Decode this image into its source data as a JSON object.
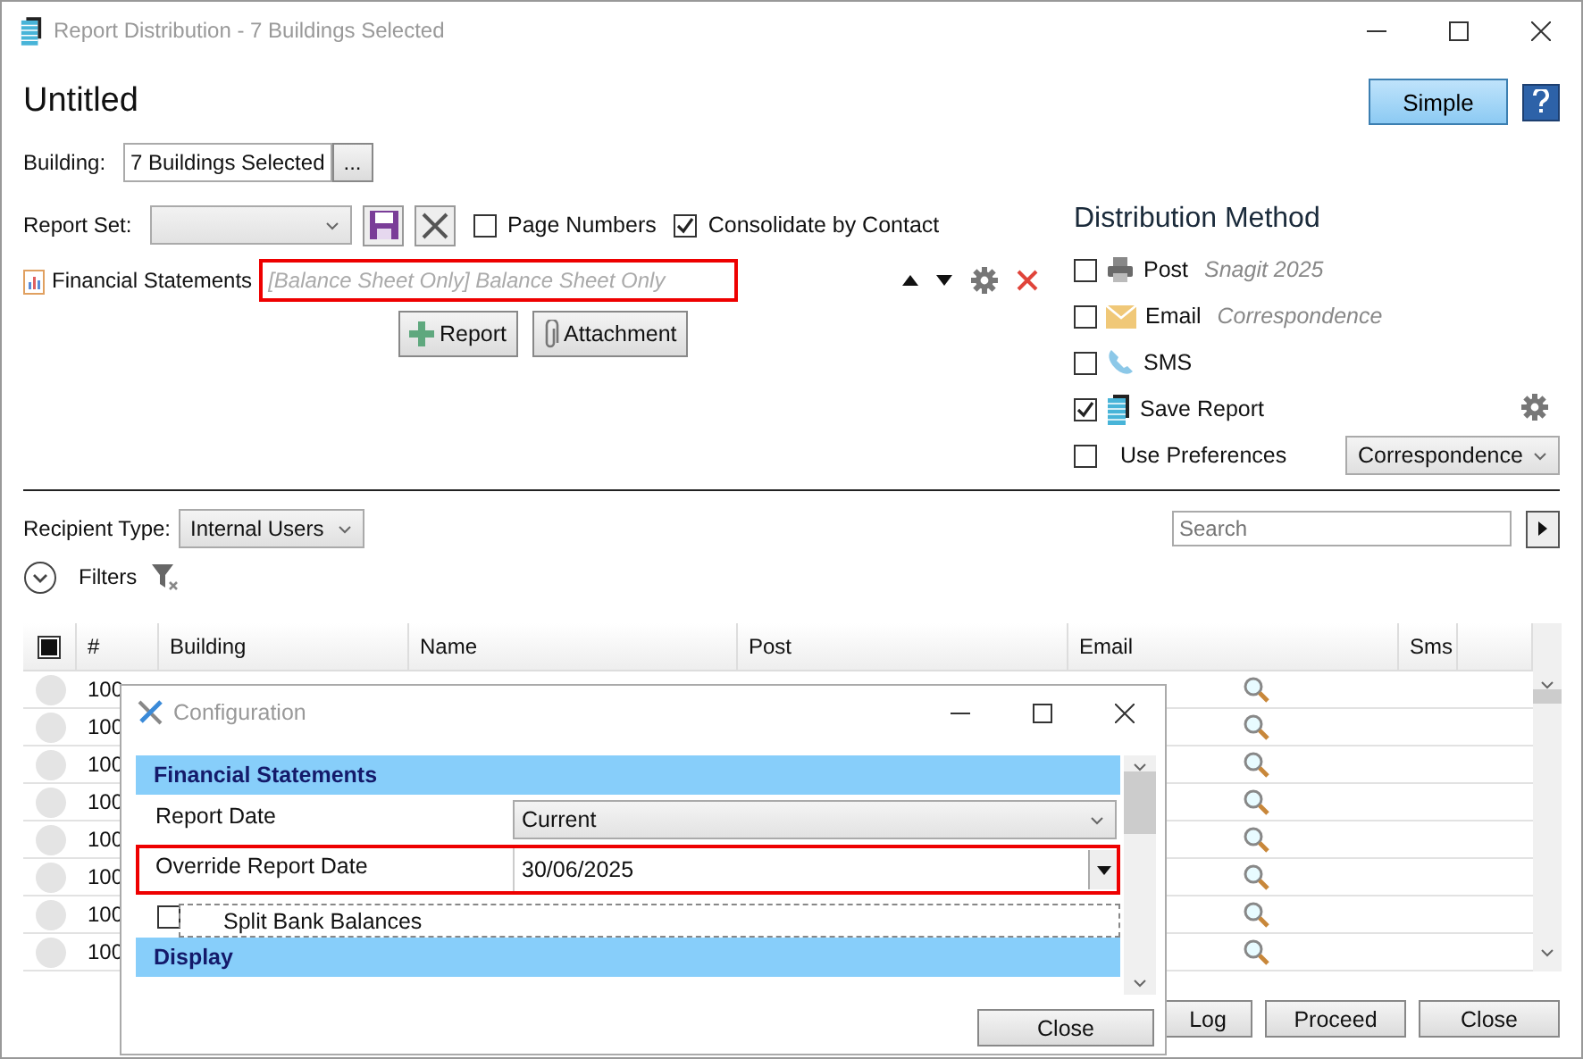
{
  "window": {
    "title": "Report Distribution - 7 Buildings Selected"
  },
  "header": {
    "title": "Untitled",
    "mode_button": "Simple"
  },
  "building": {
    "label": "Building:",
    "value": "7 Buildings Selected",
    "browse_button": "..."
  },
  "report_set": {
    "label": "Report Set:",
    "options": [
      {
        "label": "Page Numbers",
        "checked": false
      },
      {
        "label": "Consolidate by Contact",
        "checked": true
      }
    ]
  },
  "reports": [
    {
      "name": "Financial Statements",
      "description": "[Balance Sheet Only] Balance Sheet Only",
      "highlighted": true
    }
  ],
  "report_buttons": [
    {
      "kind": "add",
      "label": "Report"
    },
    {
      "kind": "attach",
      "label": "Attachment"
    }
  ],
  "distribution": {
    "title": "Distribution Method",
    "methods": [
      {
        "kind": "post",
        "label": "Post",
        "detail": "Snagit 2025",
        "checked": false
      },
      {
        "kind": "email",
        "label": "Email",
        "detail": "Correspondence",
        "checked": false
      },
      {
        "kind": "sms",
        "label": "SMS",
        "checked": false
      },
      {
        "kind": "save",
        "label": "Save Report",
        "checked": true
      },
      {
        "kind": "preferences",
        "label": "Use Preferences",
        "checked": false
      }
    ],
    "preferences_value": "Correspondence"
  },
  "recipients": {
    "label": "Recipient Type:",
    "value": "Internal Users",
    "search_placeholder": "Search",
    "filters_label": "Filters"
  },
  "table": {
    "select_all": {
      "partial": true
    },
    "columns": [
      "#",
      "Building",
      "Name",
      "Post",
      "Email",
      "Sms"
    ],
    "rows": [
      {
        "number": "100",
        "selected": false
      },
      {
        "number": "100",
        "selected": false
      },
      {
        "number": "100",
        "selected": false
      },
      {
        "number": "100",
        "selected": false
      },
      {
        "number": "100",
        "selected": false
      },
      {
        "number": "100",
        "selected": false
      },
      {
        "number": "100",
        "selected": false
      },
      {
        "number": "100",
        "selected": false
      }
    ]
  },
  "footer_buttons": [
    "Log",
    "Proceed",
    "Close"
  ],
  "dialog": {
    "title": "Configuration",
    "sections": [
      {
        "title": "Financial Statements",
        "fields": [
          {
            "kind": "dropdown",
            "label": "Report Date",
            "value": "Current",
            "highlighted": false
          },
          {
            "kind": "date",
            "label": "Override Report Date",
            "value": "30/06/2025",
            "highlighted": true
          },
          {
            "kind": "checkbox",
            "label": "Split Bank Balances",
            "checked": false
          }
        ]
      },
      {
        "title": "Display"
      }
    ],
    "close_button": "Close"
  }
}
